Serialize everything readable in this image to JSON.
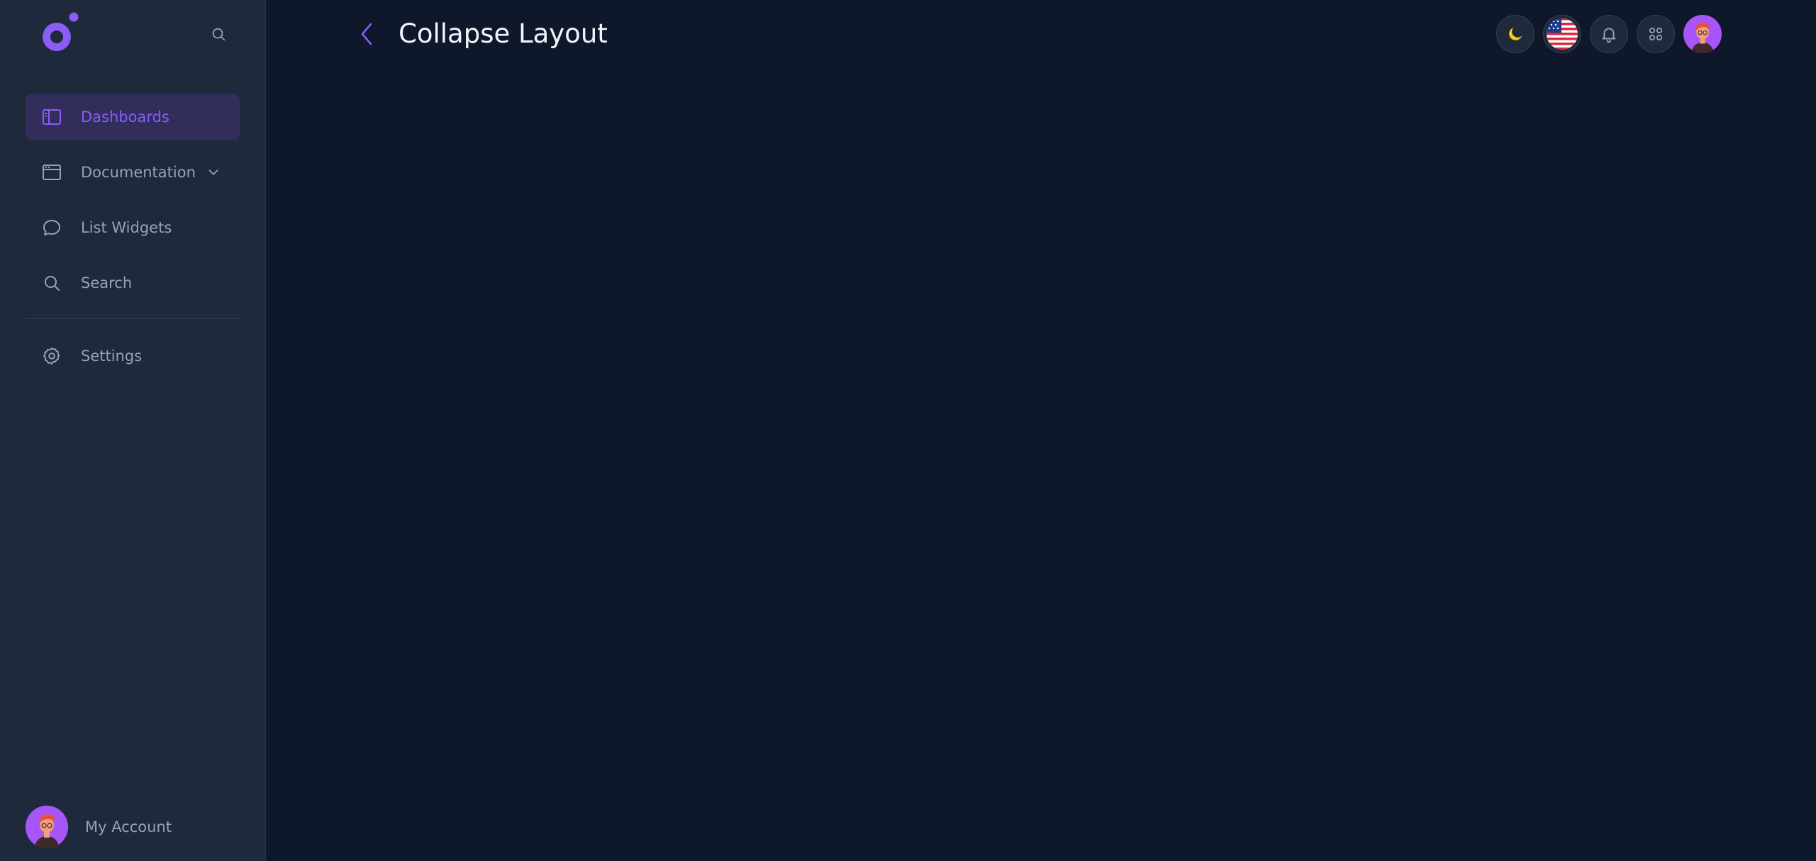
{
  "sidebar": {
    "items": [
      {
        "label": "Dashboards",
        "icon": "sidebar-layout-icon",
        "active": true
      },
      {
        "label": "Documentation",
        "icon": "browser-window-icon",
        "has_submenu": true
      },
      {
        "label": "List Widgets",
        "icon": "chat-bubble-icon"
      },
      {
        "label": "Search",
        "icon": "search-icon"
      }
    ],
    "settings": {
      "label": "Settings",
      "icon": "gear-icon"
    },
    "account": {
      "label": "My Account"
    }
  },
  "header": {
    "title": "Collapse Layout"
  },
  "colors": {
    "accent": "#8b5cf6",
    "background": "#0f172a",
    "sidebar": "#1e293b",
    "active_item_bg": "#312e5c",
    "muted_text": "#94a3b8",
    "moon": "#facc15"
  }
}
